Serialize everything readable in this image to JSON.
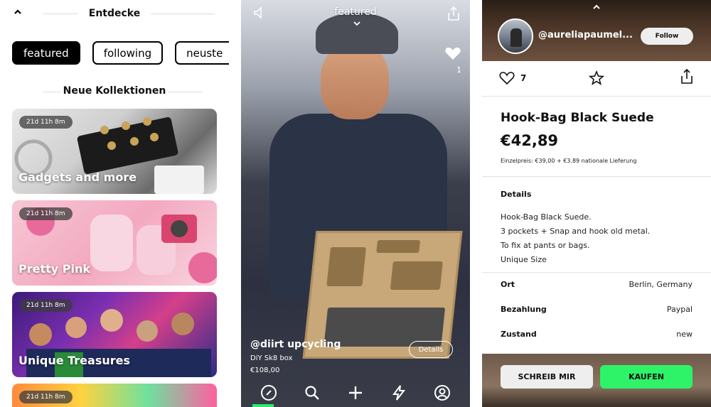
{
  "screen1": {
    "header_title": "Entdecke",
    "chips": [
      "featured",
      "following",
      "neuste"
    ],
    "section_title": "Neue Kollektionen",
    "cards": [
      {
        "badge": "21d 11h 8m",
        "title": "Gadgets and more"
      },
      {
        "badge": "21d 11h 8m",
        "title": "Pretty Pink"
      },
      {
        "badge": "21d 11h 8m",
        "title": "Unique Treasures"
      },
      {
        "badge": "21d 11h 8m",
        "title": ""
      }
    ]
  },
  "screen2": {
    "title": "featured",
    "like_count": "1",
    "user": "@diirt upcycling",
    "product": "DiY Sk8 box",
    "price": "€108,00",
    "details_label": "Details",
    "tabs": [
      "explore",
      "search",
      "add",
      "activity",
      "profile"
    ]
  },
  "screen3": {
    "username": "@aureliapaumel...",
    "follow_label": "Follow",
    "like_count": "7",
    "product_title": "Hook-Bag Black Suede",
    "price": "€42,89",
    "price_note": "Einzelpreis: €39,00 + €3.89 nationale Lieferung",
    "details_heading": "Details",
    "details_lines": [
      "Hook-Bag Black Suede.",
      "3 pockets + Snap and hook old metal.",
      "To fix at pants or bags.",
      "Unique Size"
    ],
    "rows": [
      {
        "key": "Ort",
        "value": "Berlin, Germany"
      },
      {
        "key": "Bezahlung",
        "value": "Paypal"
      },
      {
        "key": "Zustand",
        "value": "new"
      }
    ],
    "message_label": "SCHREIB MIR",
    "buy_label": "KAUFEN"
  },
  "colors": {
    "accent_green": "#2ef268",
    "tab_indicator": "#2eea6e",
    "chip_active_bg": "#000000"
  }
}
